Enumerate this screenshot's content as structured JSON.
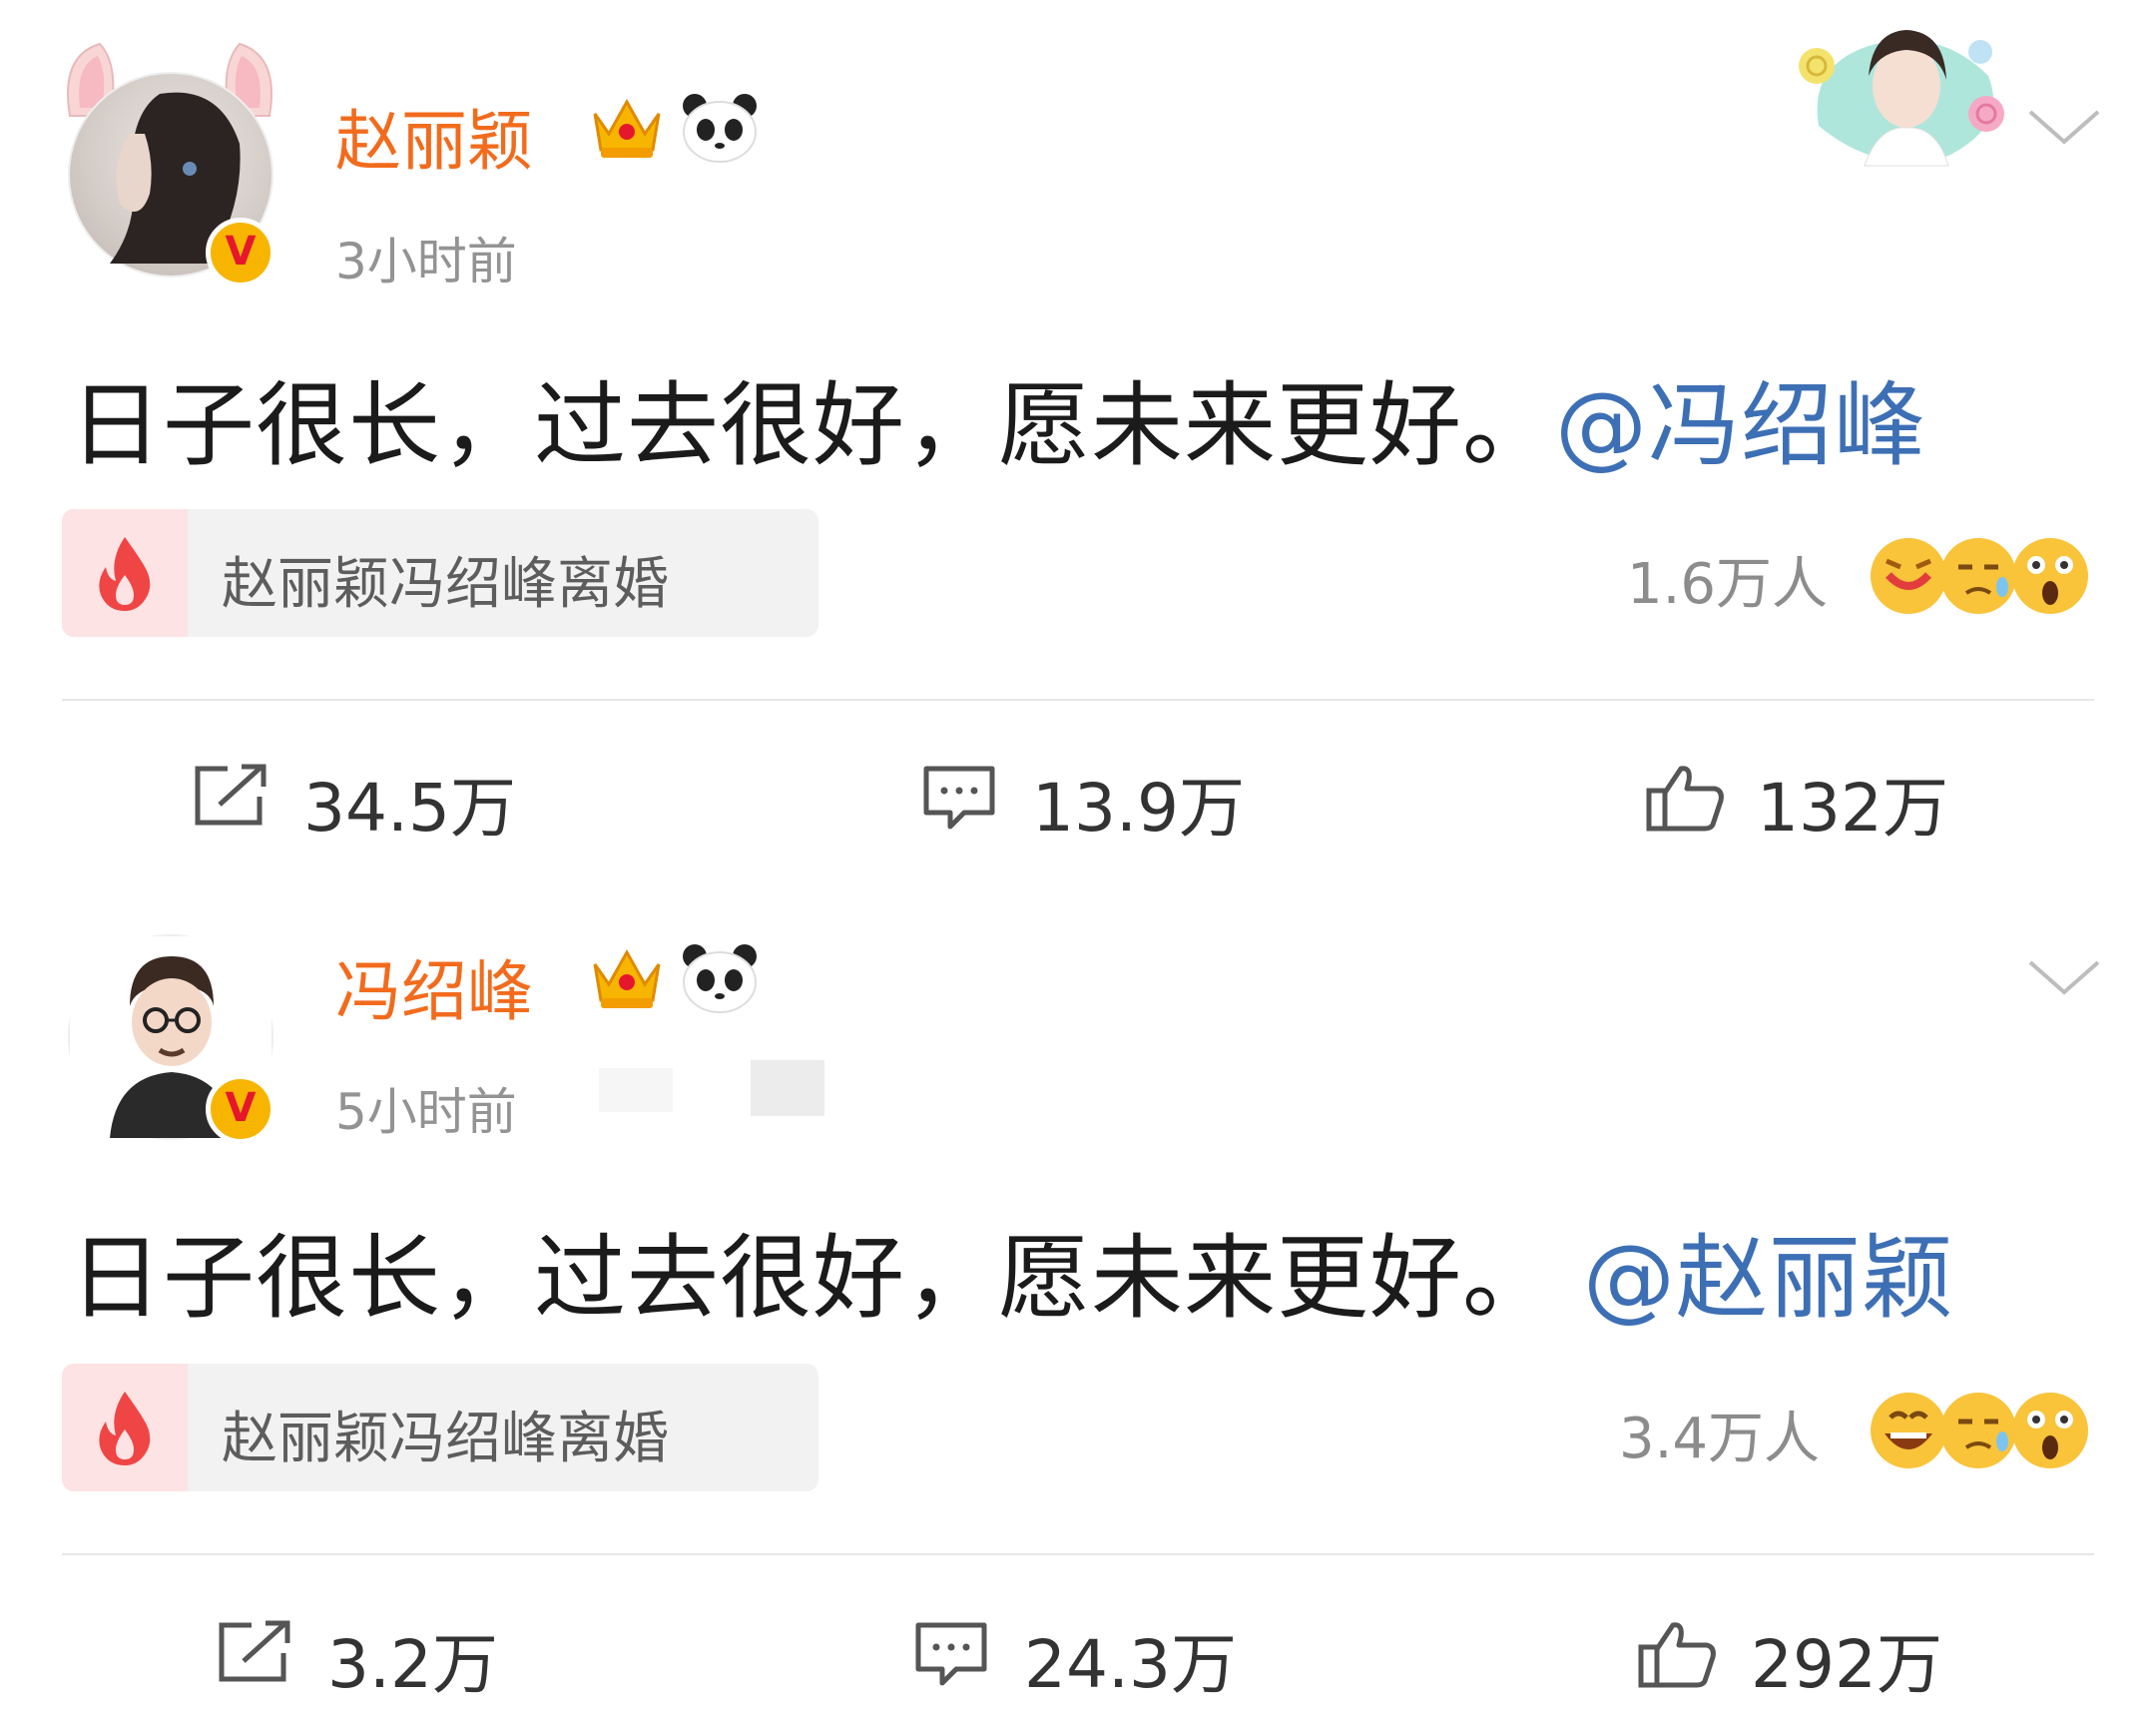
{
  "posts": [
    {
      "author": "赵丽颖",
      "time": "3小时前",
      "text": "日子很长，过去很好，愿未来更好。",
      "mention": "@冯绍峰",
      "topic": "赵丽颖冯绍峰离婚",
      "reactions_people": "1.6万人",
      "repost": "34.5万",
      "comment": "13.9万",
      "like": "132万"
    },
    {
      "author": "冯绍峰",
      "time": "5小时前",
      "text": "日子很长，过去很好，愿未来更好。",
      "mention": "@赵丽颖",
      "topic": "赵丽颖冯绍峰离婚",
      "reactions_people": "3.4万人",
      "repost": "3.2万",
      "comment": "24.3万",
      "like": "292万"
    }
  ],
  "verified_badge": "V",
  "colors": {
    "name": "#f26b1d",
    "mention": "#3d6fb5",
    "badge": "#f7b500",
    "fire": "#f04545"
  },
  "icons": [
    "crown-icon",
    "panda-icon",
    "chevron-down-icon",
    "fire-icon",
    "repost-icon",
    "comment-icon",
    "like-icon"
  ]
}
